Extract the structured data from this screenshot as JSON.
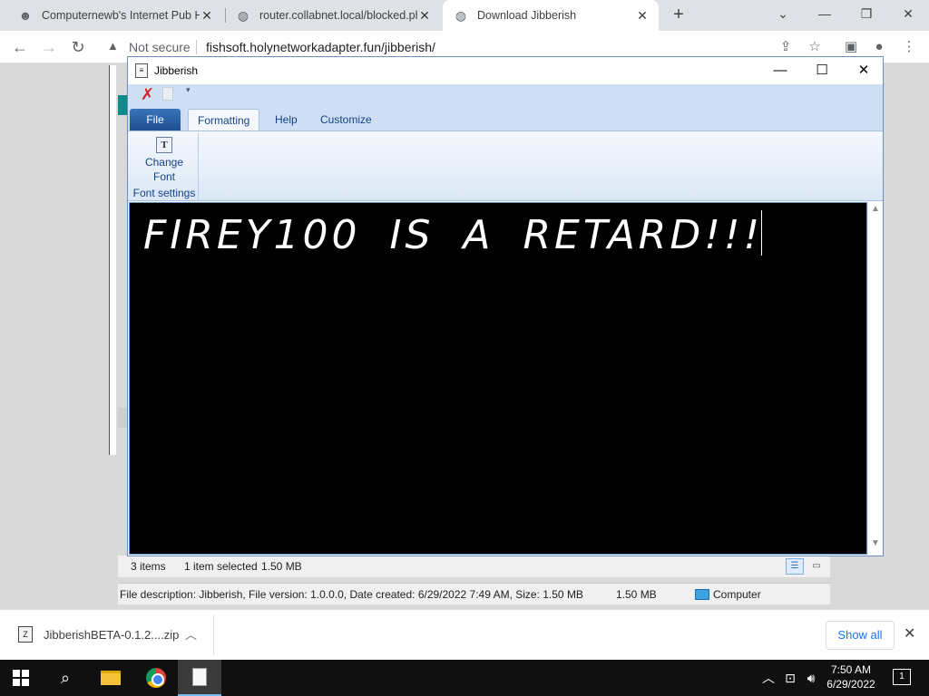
{
  "browser": {
    "tabs": [
      {
        "title": "Computernewb's Internet Pub H",
        "icon": "pub-favicon-icon",
        "active": false
      },
      {
        "title": "router.collabnet.local/blocked.ph",
        "icon": "globe-icon",
        "active": false
      },
      {
        "title": "Download Jibberish",
        "icon": "globe-icon",
        "active": true
      }
    ],
    "new_tab": "+",
    "security_label": "Not secure",
    "url": "fishsoft.holynetworkadapter.fun/jibberish/"
  },
  "explorer": {
    "items_count": "3 items",
    "selected": "1 item selected",
    "selected_size": "1.50 MB",
    "description": "File description: Jibberish, File version: 1.0.0.0, Date created: 6/29/2022 7:49 AM, Size: 1.50 MB",
    "size2": "1.50 MB",
    "location": "Computer"
  },
  "jibberish": {
    "title": "Jibberish",
    "tabs": {
      "file": "File",
      "formatting": "Formatting",
      "help": "Help",
      "customize": "Customize"
    },
    "ribbon": {
      "change_font_line1": "Change",
      "change_font_line2": "Font",
      "group_label": "Font settings"
    },
    "editor_text": "FIREY100 IS A RETARD!!!"
  },
  "downloads": {
    "file_name": "JibberishBETA-0.1.2....zip",
    "show_all": "Show all"
  },
  "taskbar": {
    "time": "7:50 AM",
    "date": "6/29/2022",
    "notification_count": "1"
  },
  "colors": {
    "editor_bg": "#000000",
    "editor_text": "#ffffff",
    "ribbon_accent": "#15428b",
    "file_tab": "#1d4f91"
  }
}
